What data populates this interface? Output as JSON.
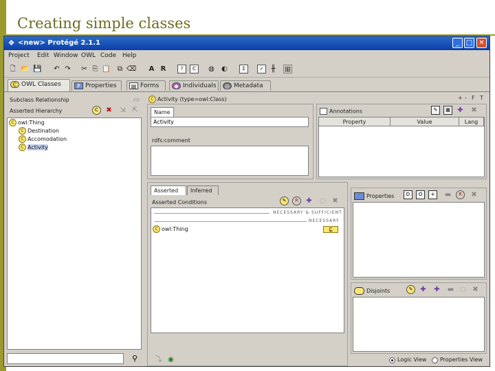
{
  "slide": {
    "title": "Creating simple classes"
  },
  "window": {
    "title": "<new>  Protégé 2.1.1"
  },
  "menu": [
    "Project",
    "Edit",
    "Window",
    "OWL",
    "Code",
    "Help"
  ],
  "toolbar": {
    "a_label": "A",
    "r_label": "R"
  },
  "tabs": [
    {
      "label": "OWL Classes",
      "icon": "owl-classes-icon"
    },
    {
      "label": "Properties",
      "icon": "properties-icon"
    },
    {
      "label": "Forms",
      "icon": "forms-icon"
    },
    {
      "label": "Individuals",
      "icon": "individuals-icon"
    },
    {
      "label": "Metadata",
      "icon": "metadata-icon"
    }
  ],
  "left_panel": {
    "relationship_header": "Subclass Relationship",
    "hierarchy_label": "Asserted Hierarchy",
    "tree": [
      {
        "label": "owl:Thing",
        "depth": 0,
        "selected": false
      },
      {
        "label": "Destination",
        "depth": 1,
        "selected": false
      },
      {
        "label": "Accomodation",
        "depth": 1,
        "selected": false
      },
      {
        "label": "Activity",
        "depth": 1,
        "selected": true
      }
    ]
  },
  "right_panel": {
    "header": "Activity   (type=owl:Class)",
    "name_tab": "Name",
    "name_value": "Activity",
    "comment_label": "rdfs:comment",
    "annotations": {
      "label": "Annotations",
      "columns": [
        "Property",
        "Value",
        "Lang"
      ]
    },
    "conditions": {
      "tabs": [
        "Asserted",
        "Inferred"
      ],
      "label": "Asserted Conditions",
      "sep_sufficient": "NECESSARY & SUFFICIENT",
      "sep_necessary": "NECESSARY",
      "items": [
        {
          "label": "owl:Thing",
          "badge": "⊑"
        }
      ]
    },
    "properties": {
      "label": "Properties"
    },
    "disjoints": {
      "label": "Disjoints"
    },
    "view_options": [
      "Logic View",
      "Properties View"
    ]
  }
}
